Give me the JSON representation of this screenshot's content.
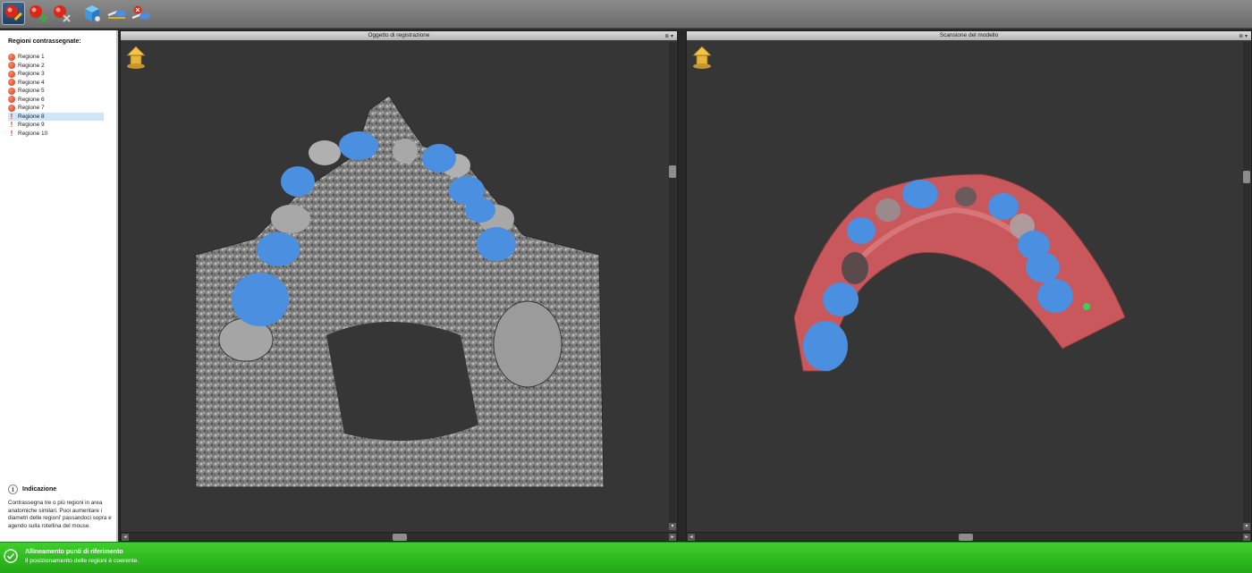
{
  "toolbar": {
    "buttons": [
      {
        "name": "mark-region-tool",
        "active": true
      },
      {
        "name": "add-region-tool",
        "active": false
      },
      {
        "name": "remove-region-tool",
        "active": false
      },
      {
        "name": "3d-view-tool",
        "active": false
      },
      {
        "name": "align-tool",
        "active": false
      },
      {
        "name": "reset-align-tool",
        "active": false
      }
    ]
  },
  "sidebar": {
    "title": "Regioni contrassegnate:",
    "regions": [
      {
        "label": "Regione 1",
        "status": "done"
      },
      {
        "label": "Regione 2",
        "status": "done"
      },
      {
        "label": "Regione 3",
        "status": "done"
      },
      {
        "label": "Regione 4",
        "status": "done"
      },
      {
        "label": "Regione 5",
        "status": "done"
      },
      {
        "label": "Regione 6",
        "status": "done"
      },
      {
        "label": "Regione 7",
        "status": "done"
      },
      {
        "label": "Regione 8",
        "status": "todo",
        "selected": true
      },
      {
        "label": "Regione 9",
        "status": "todo"
      },
      {
        "label": "Regione 10",
        "status": "todo"
      }
    ],
    "hint": {
      "title": "Indicazione",
      "text": "Contrassegna tre o più regioni in area anatomiche similari. Puoi aumentare i diametri delle regioni' passandoci sopra e agendo sulla rotellina del mouse."
    }
  },
  "viewports": {
    "left": {
      "title": "Oggetto di registrazione"
    },
    "right": {
      "title": "Scansione del modello"
    },
    "control_glyph": "⊕ ▾"
  },
  "status": {
    "title": "Allineamento punti di riferimento",
    "message": "Il posizionamento delle regioni è coerente.",
    "color": "#2dbb1e"
  },
  "colors": {
    "region_marker": "#4a8fe0",
    "scan_tissue": "#c85a5e",
    "ct_bone": "#8a8a8a"
  }
}
